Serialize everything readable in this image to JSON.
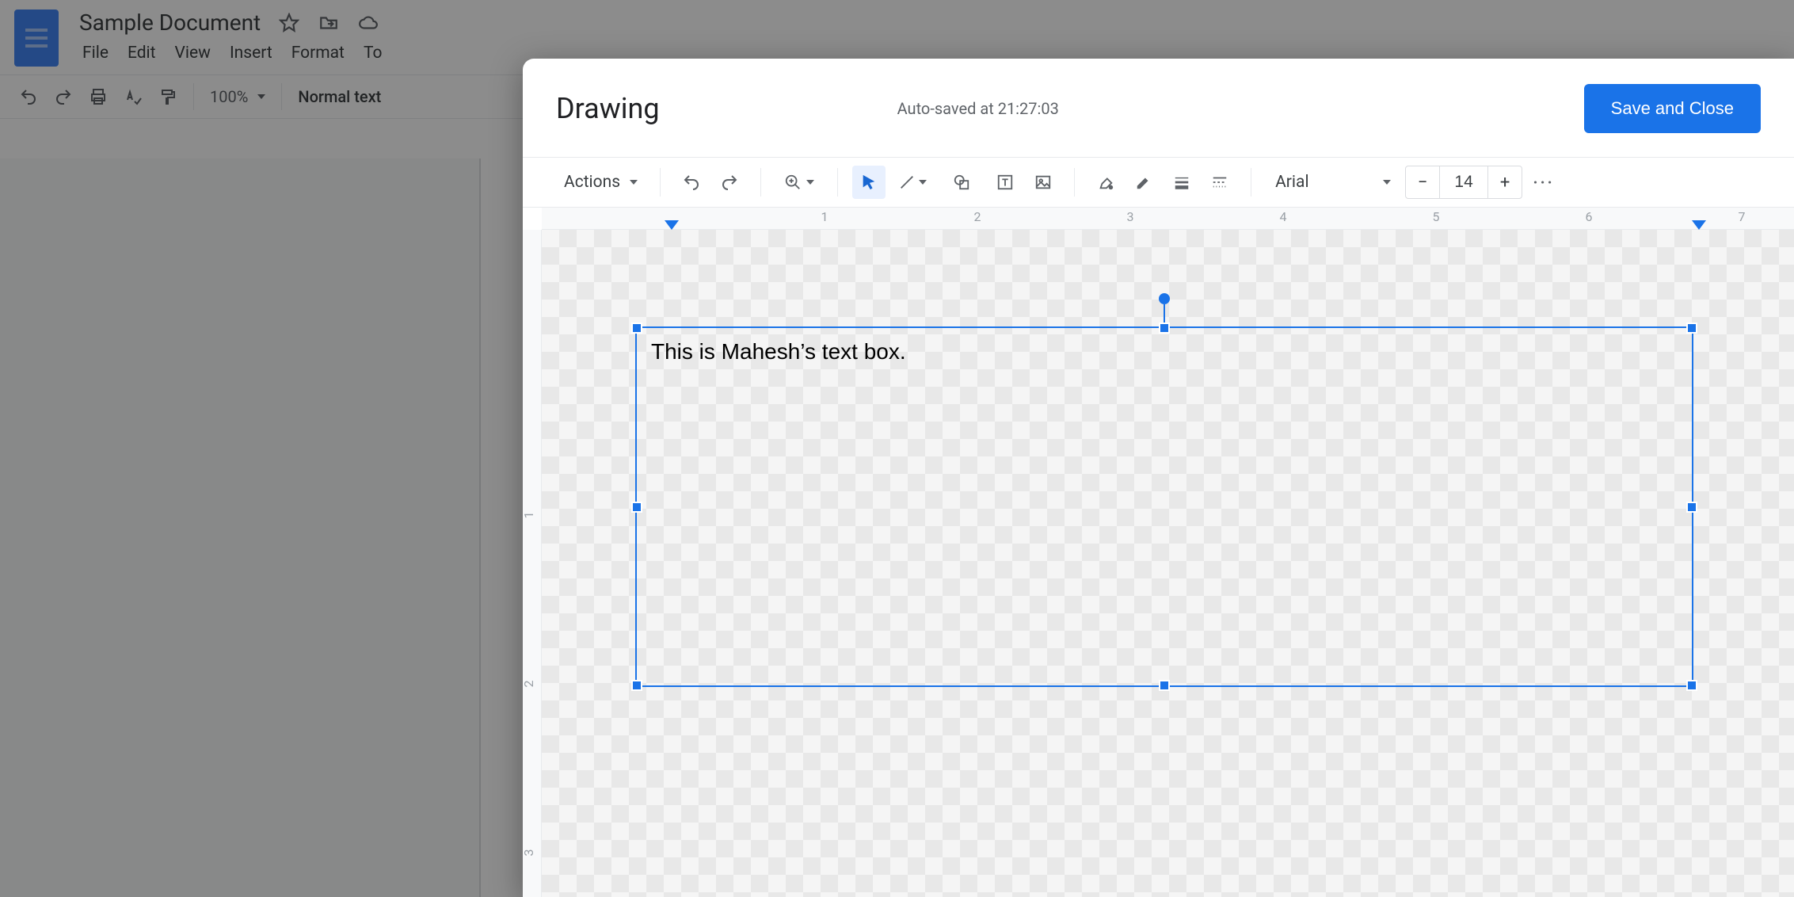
{
  "doc": {
    "title": "Sample Document",
    "menus": [
      "File",
      "Edit",
      "View",
      "Insert",
      "Format",
      "To"
    ],
    "toolbar": {
      "zoom": "100%",
      "style": "Normal text"
    }
  },
  "modal": {
    "title": "Drawing",
    "autosave": "Auto-saved at 21:27:03",
    "save": "Save and Close",
    "actions": "Actions",
    "font": "Arial",
    "font_size": "14",
    "ruler_h": [
      "1",
      "2",
      "3",
      "4",
      "5",
      "6",
      "7"
    ],
    "ruler_v": [
      "1",
      "2",
      "3"
    ],
    "textbox_content": "This is Mahesh’s text box."
  }
}
